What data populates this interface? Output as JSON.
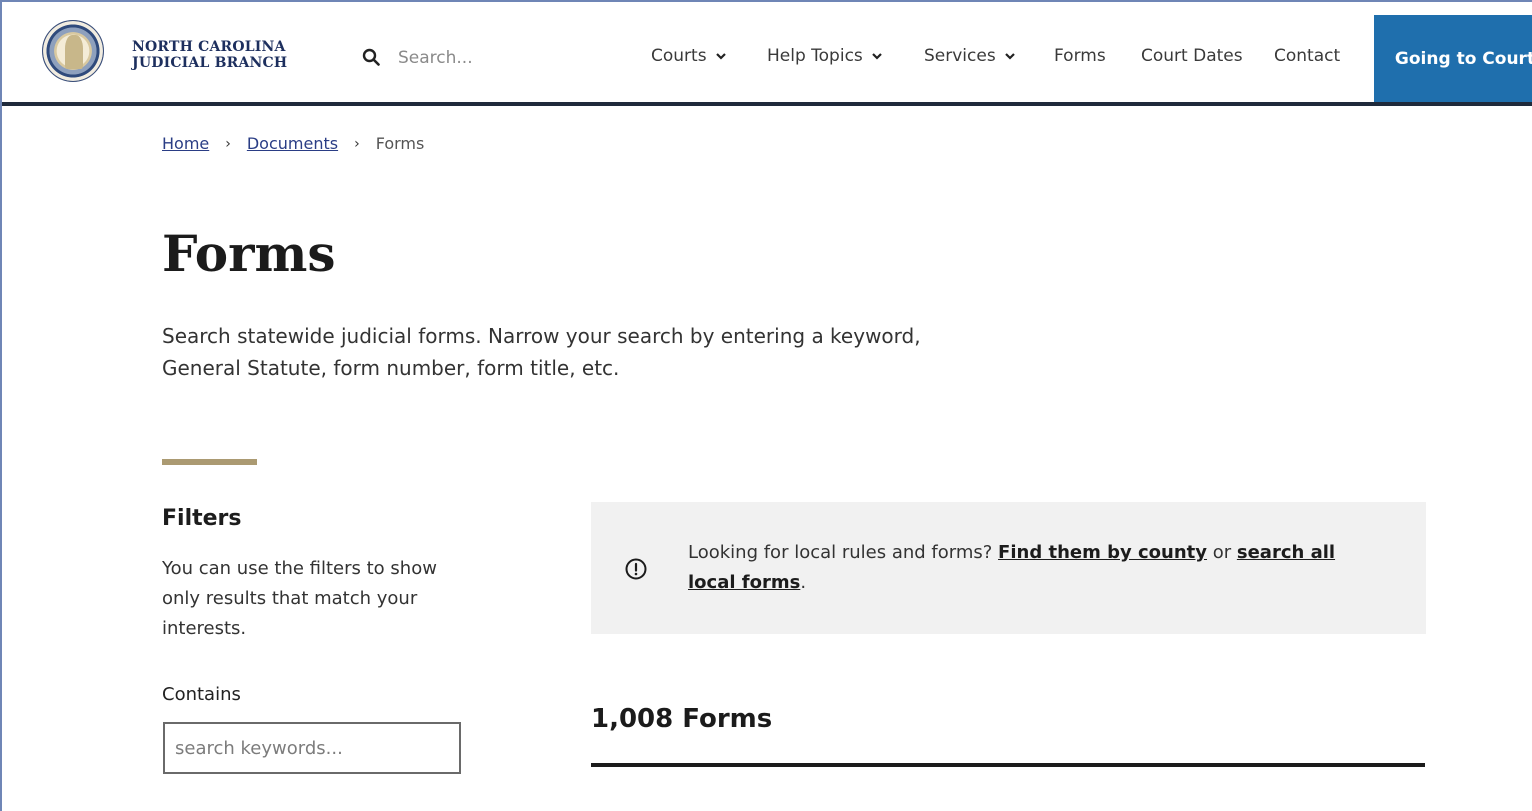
{
  "header": {
    "brand_line1": "NORTH CAROLINA",
    "brand_line2": "JUDICIAL BRANCH",
    "search_placeholder": "Search...",
    "nav": [
      {
        "label": "Courts",
        "dropdown": true
      },
      {
        "label": "Help Topics",
        "dropdown": true
      },
      {
        "label": "Services",
        "dropdown": true
      },
      {
        "label": "Forms",
        "dropdown": false
      },
      {
        "label": "Court Dates",
        "dropdown": false
      },
      {
        "label": "Contact",
        "dropdown": false
      }
    ],
    "cta_label": "Going to Court",
    "cta_color": "#1f6fad"
  },
  "breadcrumb": {
    "items": [
      "Home",
      "Documents",
      "Forms"
    ]
  },
  "page": {
    "title": "Forms",
    "intro_line1": "Search statewide judicial forms. Narrow your search by entering a keyword,",
    "intro_line2": "General Statute, form number, form title, etc."
  },
  "filters": {
    "title": "Filters",
    "description": "You can use the filters to show only results that match your interests.",
    "contains_label": "Contains",
    "keyword_placeholder": "search keywords..."
  },
  "notice": {
    "text_before": "Looking for local rules and forms? ",
    "link1": "Find them by county",
    "text_middle": " or ",
    "link2": "search all local forms",
    "text_after": "."
  },
  "results": {
    "count_label": "1,008 Forms"
  },
  "colors": {
    "accent_bar": "#ab9a72",
    "header_rule": "#1f2a3b",
    "link": "#2a3d85"
  }
}
